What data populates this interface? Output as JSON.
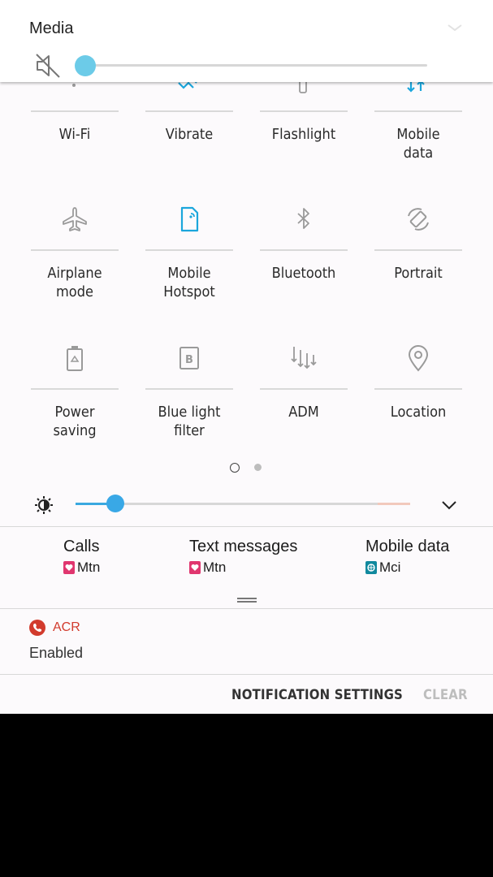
{
  "media": {
    "title": "Media",
    "volume_fraction": 0.0
  },
  "tiles": [
    {
      "label": "Wi-Fi",
      "icon": "wifi-icon",
      "active": false
    },
    {
      "label": "Vibrate",
      "icon": "vibrate-icon",
      "active": true
    },
    {
      "label": "Flashlight",
      "icon": "flashlight-icon",
      "active": false
    },
    {
      "label": "Mobile data",
      "icon": "mobile-data-icon",
      "active": true
    },
    {
      "label": "Airplane mode",
      "icon": "airplane-icon",
      "active": false
    },
    {
      "label": "Mobile Hotspot",
      "icon": "hotspot-icon",
      "active": true
    },
    {
      "label": "Bluetooth",
      "icon": "bluetooth-icon",
      "active": false
    },
    {
      "label": "Portrait",
      "icon": "rotate-icon",
      "active": false
    },
    {
      "label": "Power saving",
      "icon": "battery-icon",
      "active": false
    },
    {
      "label": "Blue light filter",
      "icon": "blue-light-icon",
      "active": false
    },
    {
      "label": "ADM",
      "icon": "adm-icon",
      "active": false
    },
    {
      "label": "Location",
      "icon": "location-icon",
      "active": false
    }
  ],
  "pager": {
    "pages": 2,
    "current": 1
  },
  "brightness": {
    "fraction": 0.12
  },
  "sim": {
    "calls": {
      "title": "Calls",
      "operator": "Mtn"
    },
    "texts": {
      "title": "Text messages",
      "operator": "Mtn"
    },
    "data": {
      "title": "Mobile data",
      "operator": "Mci"
    }
  },
  "notification": {
    "app": "ACR",
    "text": "Enabled"
  },
  "actions": {
    "settings": "NOTIFICATION SETTINGS",
    "clear": "CLEAR"
  },
  "colors": {
    "accent": "#1ba6dc",
    "acr_red": "#d23b2d",
    "mtn_badge": "#e0366f",
    "mci_badge": "#11899e"
  }
}
